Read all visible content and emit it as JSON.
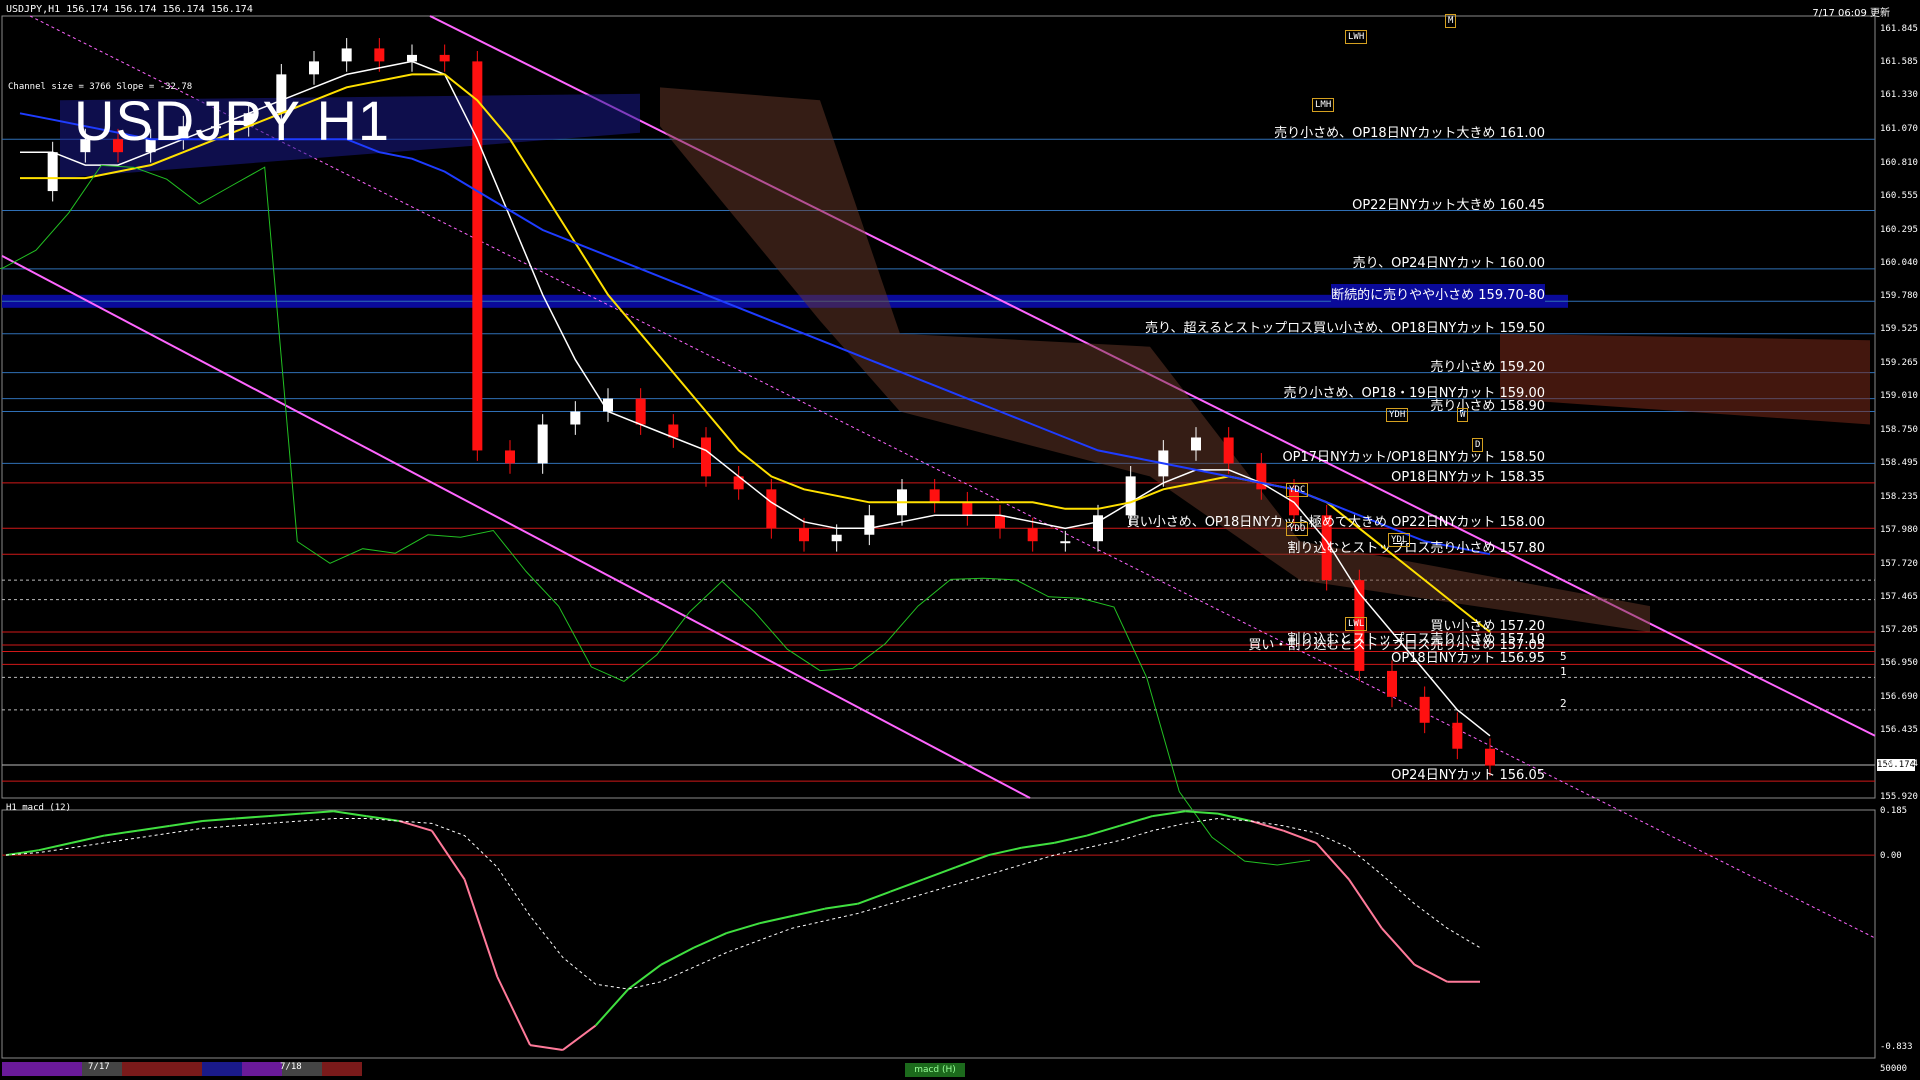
{
  "header": {
    "symbol_info": "USDJPY,H1  156.174 156.174 156.174 156.174",
    "datetime": "7/17 06:09 更新",
    "channel_info": "Channel size = 3766 Slope = -32.78",
    "title": "USDJPY H1"
  },
  "indicator_label": "H1  macd (12)",
  "current_price": "156.174",
  "footer": {
    "dates": [
      "7/17",
      "7/18"
    ],
    "tab": "macd (H)"
  },
  "price_axis": {
    "labels": [
      "161.845",
      "161.585",
      "161.330",
      "161.070",
      "160.810",
      "160.555",
      "160.295",
      "160.040",
      "159.780",
      "159.525",
      "159.265",
      "159.010",
      "158.750",
      "158.495",
      "158.235",
      "157.980",
      "157.720",
      "157.465",
      "157.205",
      "156.950",
      "156.690",
      "156.435",
      "156.174",
      "155.920"
    ]
  },
  "macd_axis": {
    "labels": [
      "0.185",
      "0.00",
      "-0.833",
      "50000"
    ]
  },
  "annotations": [
    {
      "text": "売り小さめ、OP18日NYカット大きめ 161.00",
      "price": 161.0
    },
    {
      "text": "OP22日NYカット大きめ 160.45",
      "price": 160.45
    },
    {
      "text": "売り、OP24日NYカット 160.00",
      "price": 160.0
    },
    {
      "text": "断続的に売りやや小さめ 159.70-80",
      "price": 159.75
    },
    {
      "text": "売り、超えるとストップロス買い小さめ、OP18日NYカット 159.50",
      "price": 159.5
    },
    {
      "text": "売り小さめ 159.20",
      "price": 159.2
    },
    {
      "text": "売り小さめ、OP18・19日NYカット 159.00",
      "price": 159.0
    },
    {
      "text": "売り小さめ 158.90",
      "price": 158.9
    },
    {
      "text": "OP17日NYカット/OP18日NYカット 158.50",
      "price": 158.5
    },
    {
      "text": "OP18日NYカット 158.35",
      "price": 158.35
    },
    {
      "text": "買い小さめ、OP18日NYカット極めて大きめ OP22日NYカット 158.00",
      "price": 158.0
    },
    {
      "text": "割り込むとストップロス売り小さめ 157.80",
      "price": 157.8
    },
    {
      "text": "買い小さめ 157.20",
      "price": 157.2
    },
    {
      "text": "割り込むとストップロス売り小さめ 157.10",
      "price": 157.1
    },
    {
      "text": "買い・割り込むとストップロス売り小さめ 157.05",
      "price": 157.05
    },
    {
      "text": "OP18日NYカット 156.95",
      "price": 156.95
    },
    {
      "text": "OP24日NYカット 156.05",
      "price": 156.05
    }
  ],
  "level_tags": [
    "LWH",
    "LMH",
    "YDH",
    "YDC",
    "YDO",
    "YDL",
    "LWL",
    "W",
    "D",
    "M"
  ],
  "small_numbers": [
    "5",
    "1",
    "2"
  ],
  "colors": {
    "bg": "#000000",
    "bull": "#ffffff",
    "bear": "#ff1010",
    "sma_white": "#ffffff",
    "sma_yellow": "#ffe000",
    "sma_blue": "#1e3cff",
    "channel": "#ff66ff",
    "chikou": "#22c022",
    "macd_main": "#40e040",
    "macd_signal": "#ffffff",
    "macd_neg": "#ff7a9a"
  },
  "chart_data": {
    "type": "line",
    "title": "USDJPY H1",
    "ylim": [
      155.92,
      161.95
    ],
    "series": [
      {
        "values": [
          160.6,
          160.9,
          161.0,
          160.9,
          161.0,
          161.1,
          161.1,
          161.2,
          161.5,
          161.6,
          161.7,
          161.6,
          161.65,
          161.6,
          158.6,
          158.5,
          158.8,
          158.9,
          159.0,
          158.8,
          158.7,
          158.4,
          158.3,
          158.0,
          157.9,
          157.95,
          158.1,
          158.3,
          158.2,
          158.1,
          158.0,
          157.9,
          157.9,
          158.1,
          158.4,
          158.6,
          158.7,
          158.5,
          158.3,
          158.1,
          157.6,
          156.9,
          156.7,
          156.5,
          156.3,
          156.17
        ]
      },
      {
        "values": [
          160.9,
          160.9,
          160.8,
          160.8,
          160.9,
          161.0,
          161.1,
          161.2,
          161.3,
          161.4,
          161.5,
          161.55,
          161.6,
          161.5,
          161.0,
          160.4,
          159.8,
          159.3,
          158.9,
          158.8,
          158.7,
          158.6,
          158.4,
          158.2,
          158.05,
          158.0,
          158.0,
          158.05,
          158.1,
          158.1,
          158.1,
          158.05,
          158.0,
          158.05,
          158.2,
          158.35,
          158.45,
          158.45,
          158.35,
          158.2,
          157.9,
          157.5,
          157.2,
          156.9,
          156.6,
          156.4
        ]
      },
      {
        "values": [
          160.7,
          160.7,
          160.7,
          160.75,
          160.8,
          160.9,
          161.0,
          161.1,
          161.2,
          161.3,
          161.4,
          161.45,
          161.5,
          161.5,
          161.3,
          161.0,
          160.6,
          160.2,
          159.8,
          159.5,
          159.2,
          158.9,
          158.6,
          158.4,
          158.3,
          158.25,
          158.2,
          158.2,
          158.2,
          158.2,
          158.2,
          158.2,
          158.15,
          158.15,
          158.2,
          158.3,
          158.35,
          158.4,
          158.35,
          158.3,
          158.2,
          158.0,
          157.8,
          157.6,
          157.4,
          157.2
        ]
      },
      {
        "values": [
          161.2,
          161.15,
          161.1,
          161.05,
          161.0,
          161.0,
          161.0,
          161.0,
          161.0,
          161.0,
          161.0,
          160.9,
          160.85,
          160.75,
          160.6,
          160.45,
          160.3,
          160.2,
          160.1,
          160.0,
          159.9,
          159.8,
          159.7,
          159.6,
          159.5,
          159.4,
          159.3,
          159.2,
          159.1,
          159.0,
          158.9,
          158.8,
          158.7,
          158.6,
          158.55,
          158.5,
          158.45,
          158.4,
          158.35,
          158.3,
          158.2,
          158.1,
          158.0,
          157.9,
          157.85,
          157.8
        ]
      }
    ],
    "macd": {
      "main": [
        0.0,
        0.02,
        0.05,
        0.08,
        0.1,
        0.12,
        0.14,
        0.15,
        0.16,
        0.17,
        0.18,
        0.16,
        0.14,
        0.1,
        -0.1,
        -0.5,
        -0.78,
        -0.8,
        -0.7,
        -0.55,
        -0.45,
        -0.38,
        -0.32,
        -0.28,
        -0.25,
        -0.22,
        -0.2,
        -0.15,
        -0.1,
        -0.05,
        0.0,
        0.03,
        0.05,
        0.08,
        0.12,
        0.16,
        0.18,
        0.17,
        0.14,
        0.1,
        0.05,
        -0.1,
        -0.3,
        -0.45,
        -0.52,
        -0.52
      ],
      "signal": [
        0.0,
        0.01,
        0.03,
        0.05,
        0.07,
        0.09,
        0.11,
        0.12,
        0.13,
        0.14,
        0.15,
        0.15,
        0.14,
        0.13,
        0.08,
        -0.05,
        -0.25,
        -0.42,
        -0.53,
        -0.55,
        -0.52,
        -0.46,
        -0.4,
        -0.35,
        -0.3,
        -0.27,
        -0.24,
        -0.2,
        -0.16,
        -0.12,
        -0.08,
        -0.04,
        0.0,
        0.03,
        0.06,
        0.1,
        0.13,
        0.15,
        0.14,
        0.12,
        0.09,
        0.03,
        -0.08,
        -0.2,
        -0.3,
        -0.38
      ],
      "ylim": [
        -0.833,
        0.185
      ]
    }
  }
}
